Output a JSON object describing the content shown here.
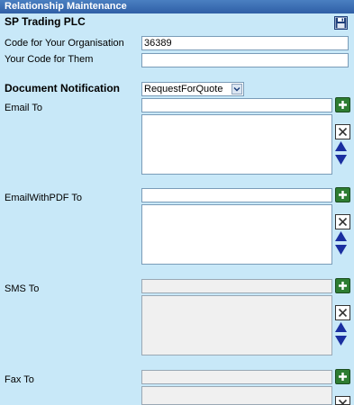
{
  "window": {
    "title": "Relationship Maintenance"
  },
  "company_name": "SP Trading PLC",
  "fields": {
    "org_code_label": "Code for Your Organisation",
    "org_code_value": "36389",
    "their_code_label": "Your Code for Them",
    "their_code_value": ""
  },
  "notification": {
    "label": "Document Notification",
    "selected": "RequestForQuote"
  },
  "sections": {
    "email": {
      "label": "Email To"
    },
    "email_pdf": {
      "label": "EmailWithPDF To"
    },
    "sms": {
      "label": "SMS To"
    },
    "fax": {
      "label": "Fax To"
    }
  },
  "icons": {
    "save": "floppy-disk-icon",
    "add": "plus-icon",
    "delete": "x-icon",
    "reorder": "up-down-arrows-icon"
  },
  "colors": {
    "background": "#c8e8f8",
    "titlebar": "#2f5fa6",
    "add_button": "#2e7d32",
    "arrow": "#1a2fa0"
  }
}
